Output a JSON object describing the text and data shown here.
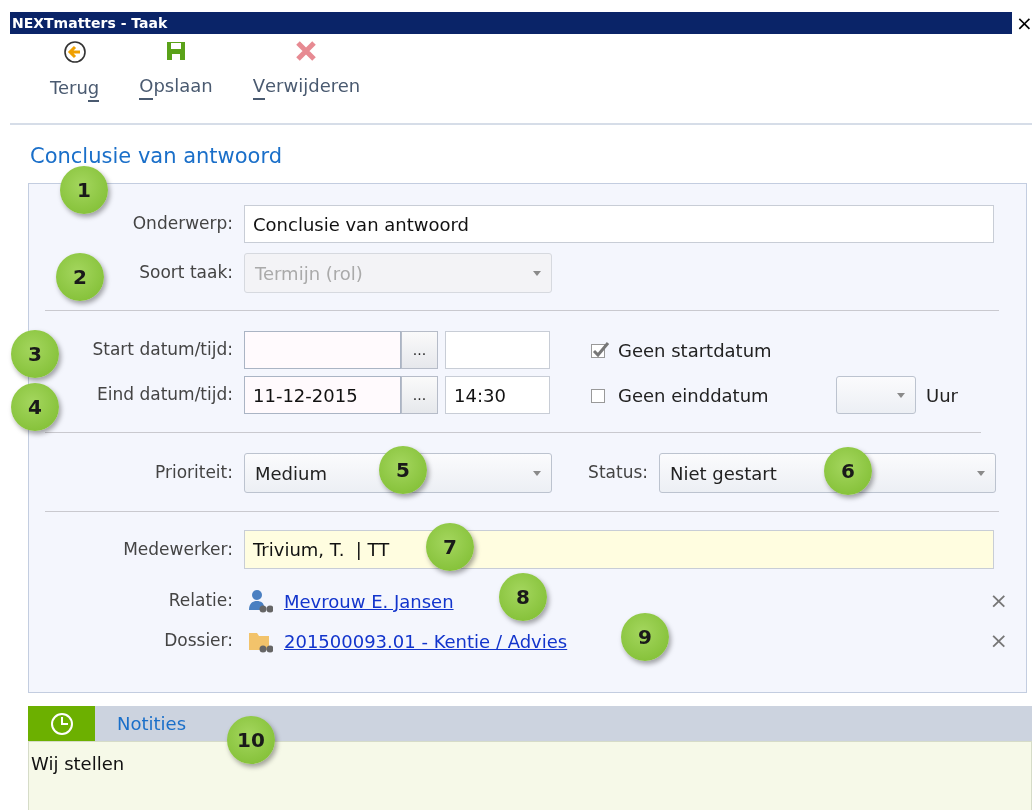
{
  "window": {
    "title": "NEXTmatters - Taak",
    "close": "×"
  },
  "toolbar": [
    {
      "kind": "back",
      "label_parts": [
        {
          "text": "Teru",
          "underlined": false
        },
        {
          "text": "g",
          "underlined": true
        }
      ]
    },
    {
      "kind": "save",
      "label_parts": [
        {
          "text": "O",
          "underlined": true
        },
        {
          "text": "pslaan",
          "underlined": false
        }
      ]
    },
    {
      "kind": "delete",
      "label_parts": [
        {
          "text": "V",
          "underlined": true
        },
        {
          "text": "erwijderen",
          "underlined": false
        }
      ]
    }
  ],
  "heading": "Conclusie van antwoord",
  "form": {
    "onderwerp": {
      "label": "Onderwerp:",
      "value": "Conclusie van antwoord",
      "callout": "1"
    },
    "soort_taak": {
      "label": "Soort taak:",
      "value": "Termijn (rol)",
      "disabled": true,
      "callout": "2"
    },
    "start": {
      "label": "Start datum/tijd:",
      "picker": "...",
      "callout": "3",
      "no_date": {
        "label": "Geen startdatum",
        "checked": true
      }
    },
    "end": {
      "label": "Eind datum/tijd:",
      "date": "11-12-2015",
      "picker": "...",
      "time": "14:30",
      "callout": "4",
      "no_date": {
        "label": "Geen einddatum",
        "checked": false
      },
      "unit": "Uur"
    },
    "prioriteit": {
      "label": "Prioriteit:",
      "value": "Medium",
      "callout": "5"
    },
    "status": {
      "label": "Status:",
      "value": "Niet gestart",
      "callout": "6"
    },
    "medewerker": {
      "label": "Medewerker:",
      "value": "Trivium, T.  | TT",
      "callout": "7"
    },
    "links": [
      {
        "kind": "person",
        "label": "Relatie:",
        "value": "Mevrouw E. Jansen",
        "remove": "×",
        "callout": "8"
      },
      {
        "kind": "folder",
        "label": "Dossier:",
        "value": "201500093.01 - Kentie / Advies",
        "remove": "×",
        "callout": "9"
      }
    ]
  },
  "notes": {
    "tab": "Notities",
    "text": "Wij stellen",
    "callout": "10"
  }
}
